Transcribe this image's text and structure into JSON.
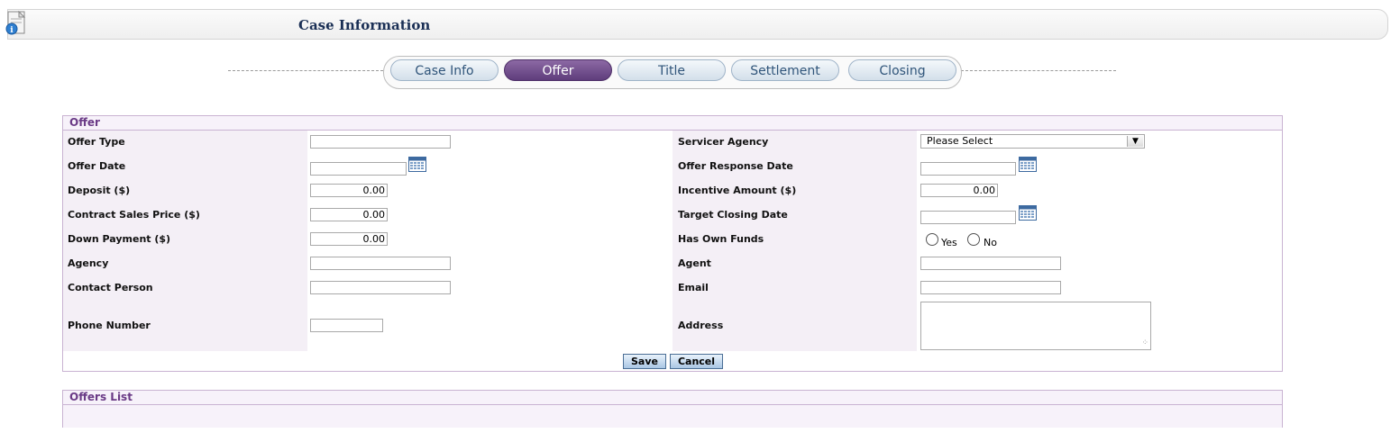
{
  "header": {
    "title": "Case Information"
  },
  "tabs": [
    {
      "label": "Case Info"
    },
    {
      "label": "Offer",
      "active": true
    },
    {
      "label": "Title"
    },
    {
      "label": "Settlement"
    },
    {
      "label": "Closing"
    }
  ],
  "offer_panel": {
    "title": "Offer",
    "fields": {
      "offer_type": {
        "label": "Offer Type",
        "value": ""
      },
      "offer_date": {
        "label": "Offer Date",
        "value": ""
      },
      "deposit": {
        "label": "Deposit ($)",
        "value": "0.00"
      },
      "contract_sales_price": {
        "label": "Contract Sales Price ($)",
        "value": "0.00"
      },
      "down_payment": {
        "label": "Down Payment ($)",
        "value": "0.00"
      },
      "agency": {
        "label": "Agency",
        "value": ""
      },
      "contact_person": {
        "label": "Contact Person",
        "value": ""
      },
      "phone_number": {
        "label": "Phone Number",
        "value": ""
      },
      "servicer_agency": {
        "label": "Servicer Agency",
        "value": "Please Select"
      },
      "offer_response_date": {
        "label": "Offer Response Date",
        "value": ""
      },
      "incentive_amount": {
        "label": "Incentive Amount ($)",
        "value": "0.00"
      },
      "target_closing_date": {
        "label": "Target Closing Date",
        "value": ""
      },
      "has_own_funds": {
        "label": "Has Own Funds",
        "options": [
          "Yes",
          "No"
        ]
      },
      "agent": {
        "label": "Agent",
        "value": ""
      },
      "email": {
        "label": "Email",
        "value": ""
      },
      "address": {
        "label": "Address",
        "value": ""
      }
    },
    "save_label": "Save",
    "cancel_label": "Cancel"
  },
  "offers_list": {
    "title": "Offers List"
  },
  "colors": {
    "accent": "#6a3a86",
    "active_tab": "#6b4a8a",
    "tab": "#dfe8f0",
    "shade": "#f4eff6"
  }
}
